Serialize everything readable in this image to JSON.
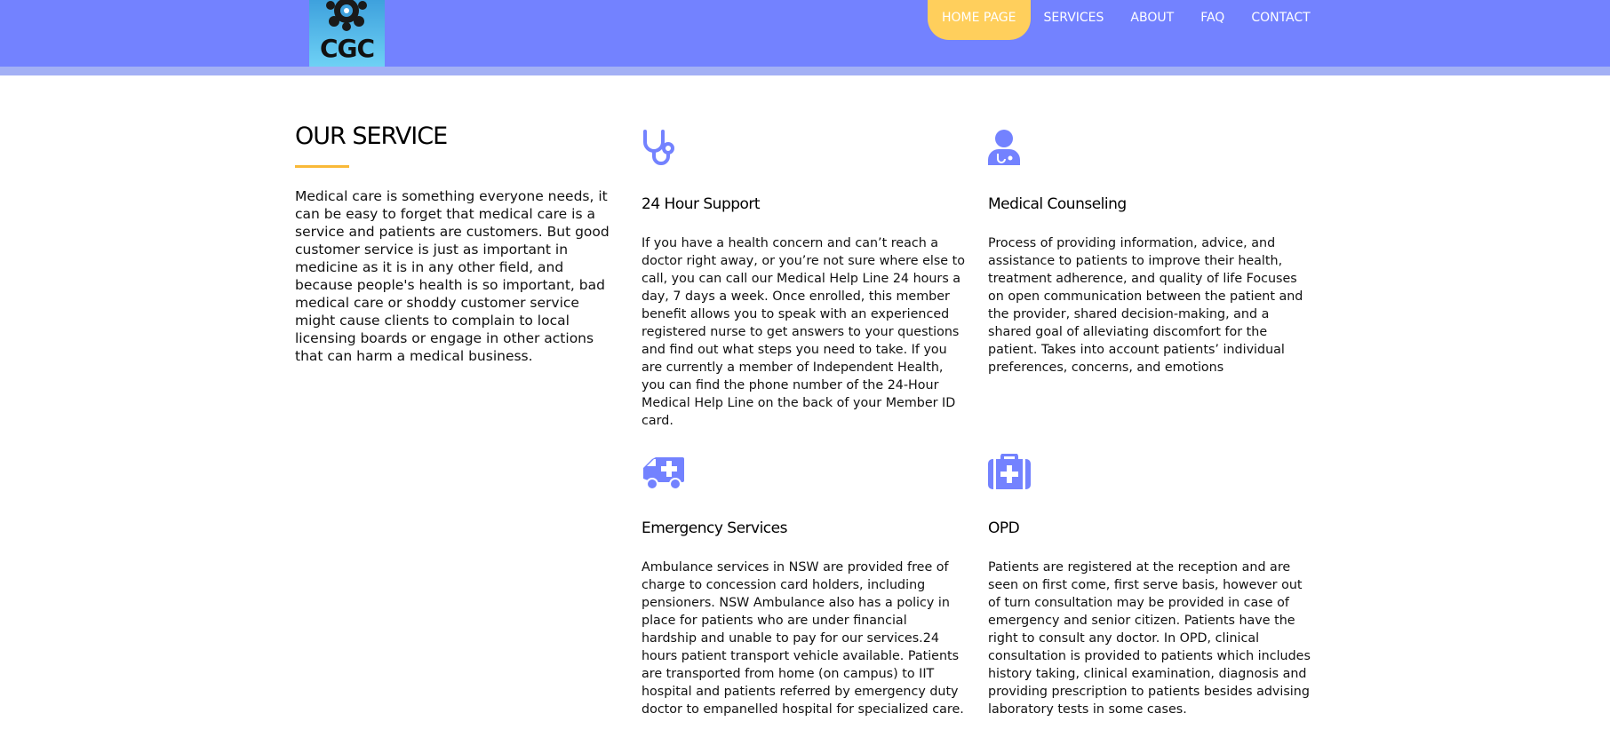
{
  "header": {
    "logo_text": "CGC",
    "nav": [
      {
        "label": "HOME PAGE",
        "active": true
      },
      {
        "label": "SERVICES"
      },
      {
        "label": "ABOUT"
      },
      {
        "label": "FAQ"
      },
      {
        "label": "CONTACT"
      }
    ]
  },
  "colors": {
    "header_bg": "#7382ff",
    "header_strip": "#a3b0f5",
    "nav_active_bg": "#ffcf5c",
    "accent_underline": "#f9b938",
    "icon_color": "#7382ff"
  },
  "intro": {
    "title": "OUR SERVICE",
    "text": "Medical care is something everyone needs, it can be easy to forget that medical care is a service and patients are customers. But good customer service is just as important in medicine as it is in any other field, and because people's health is so important, bad medical care or shoddy customer service might cause clients to complain to local licensing boards or engage in other actions that can harm a medical business."
  },
  "services": [
    {
      "icon": "stethoscope-icon",
      "title": "24 Hour Support",
      "text": "If you have a health concern and can’t reach a doctor right away, or you’re not sure where else to call, you can call our Medical Help Line 24 hours a day, 7 days a week. Once enrolled, this member benefit allows you to speak with an experienced registered nurse to get answers to your questions and find out what steps you need to take. If you are currently a member of Independent Health, you can find the phone number of the 24-Hour Medical Help Line on the back of your Member ID card."
    },
    {
      "icon": "doctor-icon",
      "title": "Medical Counseling",
      "text": "Process of providing information, advice, and assistance to patients to improve their health, treatment adherence, and quality of life Focuses on open communication between the patient and the provider, shared decision-making, and a shared goal of alleviating discomfort for the patient. Takes into account patients’ individual preferences, concerns, and emotions"
    },
    {
      "icon": "ambulance-icon",
      "title": "Emergency Services",
      "text": "Ambulance services in NSW are provided free of charge to concession card holders, including pensioners. NSW Ambulance also has a policy in place for patients who are under financial hardship and unable to pay for our services.24 hours patient transport vehicle available. Patients are transported from home (on campus) to IIT hospital and patients referred by emergency duty doctor to empanelled hospital for specialized care."
    },
    {
      "icon": "medical-kit-icon",
      "title": "OPD",
      "text": "Patients are registered at the reception and are seen on first come, first serve basis, however out of turn consultation may be provided in case of emergency and senior citizen. Patients have the right to consult any doctor. In OPD, clinical consultation is provided to patients which includes history taking, clinical examination, diagnosis and providing prescription to patients besides advising laboratory tests in some cases."
    }
  ]
}
